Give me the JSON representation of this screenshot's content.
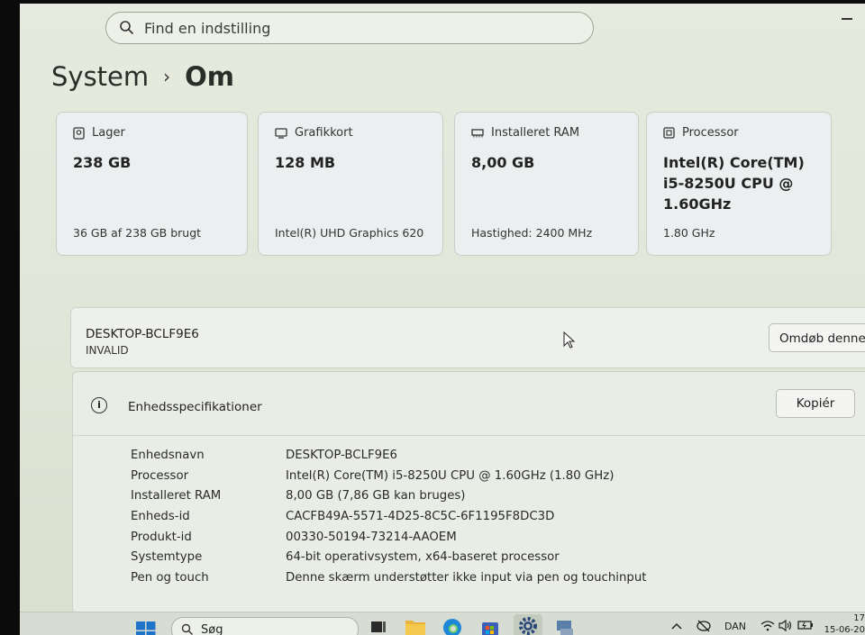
{
  "search": {
    "placeholder": "Find en indstilling"
  },
  "breadcrumb": {
    "parent": "System",
    "separator": "›",
    "current": "Om"
  },
  "cards": [
    {
      "title": "Lager",
      "value": "238 GB",
      "sub": "36 GB af 238 GB brugt",
      "icon": "storage-icon"
    },
    {
      "title": "Grafikkort",
      "value": "128 MB",
      "sub": "Intel(R) UHD Graphics 620",
      "icon": "gpu-icon"
    },
    {
      "title": "Installeret RAM",
      "value": "8,00 GB",
      "sub": "Hastighed: 2400 MHz",
      "icon": "ram-icon"
    },
    {
      "title": "Processor",
      "value": "Intel(R) Core(TM) i5-8250U CPU @ 1.60GHz",
      "sub": "1.80 GHz",
      "icon": "processor-icon"
    }
  ],
  "device": {
    "name": "DESKTOP-BCLF9E6",
    "status": "INVALID",
    "rename_label": "Omdøb denne p"
  },
  "specs": {
    "title": "Enhedsspecifikationer",
    "copy_label": "Kopiér",
    "rows": [
      {
        "key": "Enhedsnavn",
        "value": "DESKTOP-BCLF9E6"
      },
      {
        "key": "Processor",
        "value": "Intel(R) Core(TM) i5-8250U CPU @ 1.60GHz (1.80 GHz)"
      },
      {
        "key": "Installeret RAM",
        "value": "8,00 GB (7,86 GB kan bruges)"
      },
      {
        "key": "Enheds-id",
        "value": "CACFB49A-5571-4D25-8C5C-6F1195F8DC3D"
      },
      {
        "key": "Produkt-id",
        "value": "00330-50194-73214-AAOEM"
      },
      {
        "key": "Systemtype",
        "value": "64-bit operativsystem, x64-baseret processor"
      },
      {
        "key": "Pen og touch",
        "value": "Denne skærm understøtter ikke input via pen og touchinput"
      }
    ]
  },
  "taskbar": {
    "search_label": "Søg",
    "language": "DAN",
    "time": "17",
    "date": "15-06-20"
  }
}
